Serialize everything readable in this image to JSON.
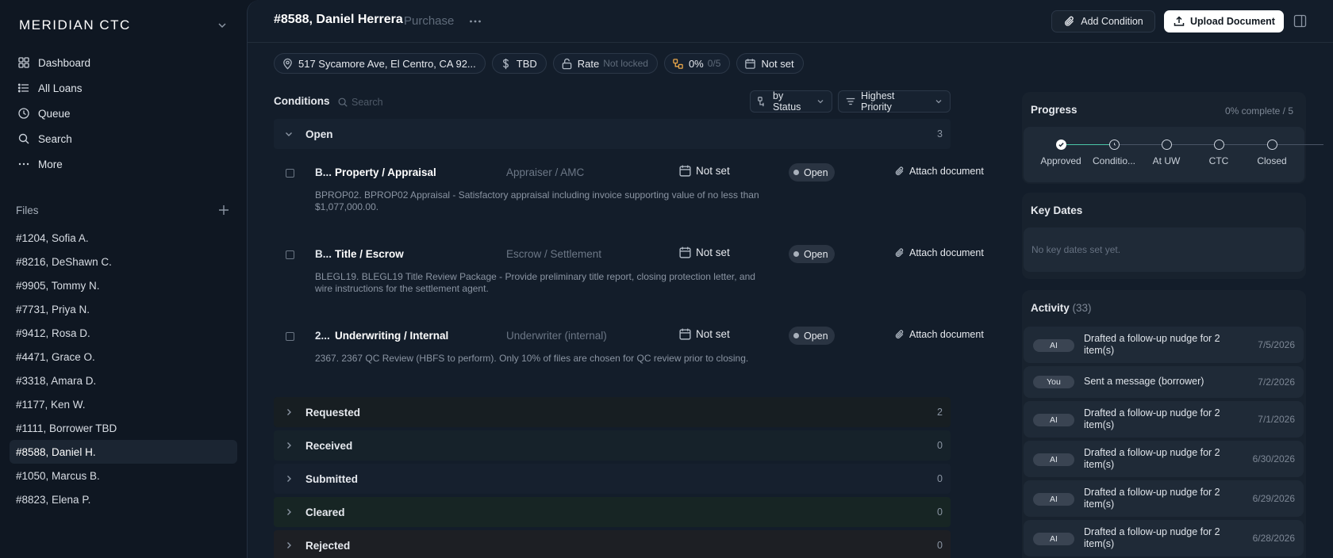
{
  "app": {
    "brand": "MERIDIAN CTC"
  },
  "sidebar": {
    "nav": [
      {
        "label": "Dashboard",
        "icon": "grid-icon"
      },
      {
        "label": "All Loans",
        "icon": "list-icon"
      },
      {
        "label": "Queue",
        "icon": "clock-icon"
      },
      {
        "label": "Search",
        "icon": "search-icon"
      },
      {
        "label": "More",
        "icon": "more-icon"
      }
    ],
    "files_label": "Files",
    "files": [
      "#1204, Sofia A.",
      "#8216, DeShawn C.",
      "#9905, Tommy N.",
      "#7731, Priya N.",
      "#9412, Rosa D.",
      "#4471, Grace O.",
      "#3318, Amara D.",
      "#1177, Ken W.",
      "#1111, Borrower TBD",
      "#8588, Daniel H.",
      "#1050, Marcus B.",
      "#8823, Elena P."
    ],
    "active_file": "#8588, Daniel H."
  },
  "header": {
    "title": "#8588, Daniel Herrera",
    "subtitle": "Purchase",
    "add_condition": "Add Condition",
    "upload_document": "Upload Document"
  },
  "chips": {
    "address": "517 Sycamore Ave, El Centro, CA 92...",
    "amount": "TBD",
    "rate_label": "Rate",
    "rate_status": "Not locked",
    "progress_pct": "0%",
    "progress_count": "0/5",
    "date": "Not set"
  },
  "conditions": {
    "title": "Conditions",
    "search_placeholder": "Search",
    "group_by": "by Status",
    "sort": "Highest Priority",
    "open_group": {
      "label": "Open",
      "count": "3"
    },
    "items": [
      {
        "code": "B...",
        "name": "Property / Appraisal",
        "party": "Appraiser / AMC",
        "date": "Not set",
        "status": "Open",
        "action": "Attach document",
        "description": "BPROP02. BPROP02 Appraisal - Satisfactory appraisal including invoice supporting value of no less than $1,077,000.00."
      },
      {
        "code": "B...",
        "name": "Title / Escrow",
        "party": "Escrow / Settlement",
        "date": "Not set",
        "status": "Open",
        "action": "Attach document",
        "description": "BLEGL19. BLEGL19 Title Review Package - Provide preliminary title report, closing protection letter, and wire instructions for the settlement agent."
      },
      {
        "code": "2...",
        "name": "Underwriting / Internal",
        "party": "Underwriter (internal)",
        "date": "Not set",
        "status": "Open",
        "action": "Attach document",
        "description": "2367. 2367 QC Review (HBFS to perform). Only 10% of files are chosen for QC review prior to closing."
      }
    ],
    "groups": [
      {
        "label": "Requested",
        "count": "2"
      },
      {
        "label": "Received",
        "count": "0"
      },
      {
        "label": "Submitted",
        "count": "0"
      },
      {
        "label": "Cleared",
        "count": "0"
      },
      {
        "label": "Rejected",
        "count": "0"
      }
    ]
  },
  "progress": {
    "title": "Progress",
    "summary": "0% complete / 5",
    "steps": [
      {
        "label": "Approved",
        "state": "done"
      },
      {
        "label": "Conditio...",
        "state": "current"
      },
      {
        "label": "At UW",
        "state": "pending"
      },
      {
        "label": "CTC",
        "state": "pending"
      },
      {
        "label": "Closed",
        "state": "pending"
      }
    ],
    "accent": "#4bc6a8"
  },
  "key_dates": {
    "title": "Key Dates",
    "empty": "No key dates set yet."
  },
  "activity": {
    "title": "Activity",
    "count": "(33)",
    "items": [
      {
        "badge": "AI",
        "text": "Drafted a follow-up nudge for 2 item(s)",
        "date": "7/5/2026"
      },
      {
        "badge": "You",
        "text": "Sent a message (borrower)",
        "date": "7/2/2026"
      },
      {
        "badge": "AI",
        "text": "Drafted a follow-up nudge for 2 item(s)",
        "date": "7/1/2026"
      },
      {
        "badge": "AI",
        "text": "Drafted a follow-up nudge for 2 item(s)",
        "date": "6/30/2026"
      },
      {
        "badge": "AI",
        "text": "Drafted a follow-up nudge for 2 item(s)",
        "date": "6/29/2026"
      },
      {
        "badge": "AI",
        "text": "Drafted a follow-up nudge for 2 item(s)",
        "date": "6/28/2026"
      }
    ]
  }
}
